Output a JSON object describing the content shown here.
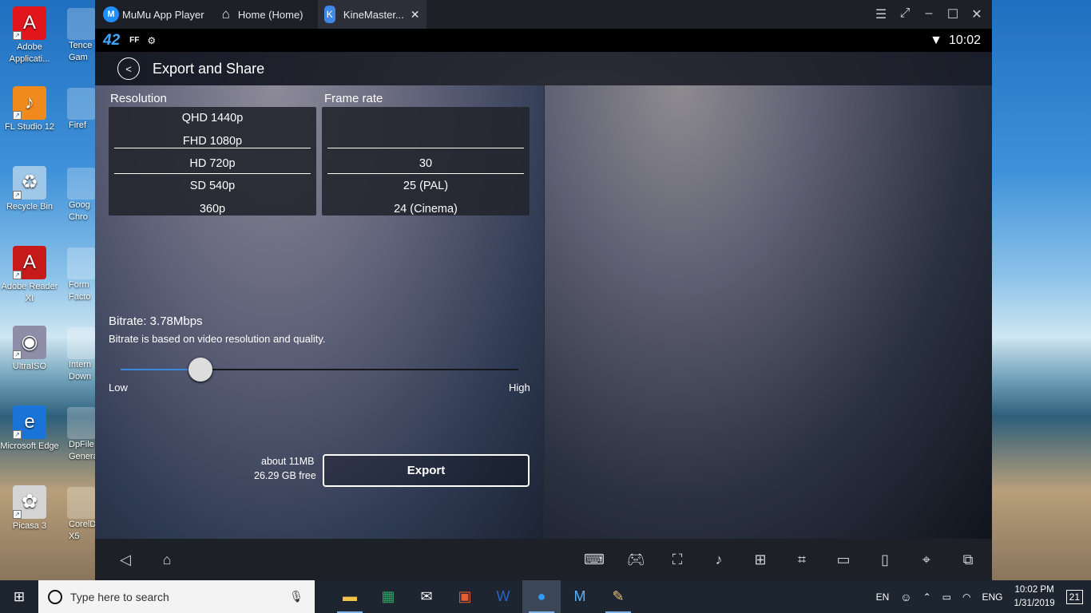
{
  "desktop": {
    "icons": [
      {
        "name": "adobe-applications-icon",
        "label": "Adobe Applicati...",
        "color": "#e0161c",
        "glyph": "A"
      },
      {
        "name": "fl-studio-icon",
        "label": "FL Studio 12",
        "color": "#f08a1c",
        "glyph": "♪"
      },
      {
        "name": "recycle-bin-icon",
        "label": "Recycle Bin",
        "color": "#9fc7e8",
        "glyph": "♻"
      },
      {
        "name": "adobe-reader-icon",
        "label": "Adobe Reader XI",
        "color": "#c71a1a",
        "glyph": "A"
      },
      {
        "name": "ultraiso-icon",
        "label": "UltraISO",
        "color": "#8e8ea8",
        "glyph": "◉"
      },
      {
        "name": "microsoft-edge-icon",
        "label": "Microsoft Edge",
        "color": "#1a74d8",
        "glyph": "e"
      },
      {
        "name": "picasa-icon",
        "label": "Picasa 3",
        "color": "#d4d4d4",
        "glyph": "✿"
      }
    ],
    "col2": [
      "Tence Gam",
      "Firef",
      "Goog Chro",
      "Form Facto",
      "Intern Down",
      "DpFile Genera",
      "CorelD X5"
    ]
  },
  "mumu": {
    "app_title": "MuMu App Player",
    "home_tab": "Home (Home)",
    "active_tab": "KineMaster...",
    "status": {
      "notif_num": "42",
      "ff": "FF",
      "time": "10:02"
    },
    "header_title": "Export and Share",
    "resolution_label": "Resolution",
    "framerate_label": "Frame rate",
    "resolutions": [
      "QHD 1440p",
      "FHD 1080p",
      "HD 720p",
      "SD 540p",
      "360p"
    ],
    "framerates": [
      "",
      "",
      "30",
      "25 (PAL)",
      "24 (Cinema)"
    ],
    "bitrate_title": "Bitrate: 3.78Mbps",
    "bitrate_desc": "Bitrate is based on video resolution and quality.",
    "slider": {
      "low": "Low",
      "high": "High",
      "value": 0.2
    },
    "size_estimate": "about 11MB",
    "free_space": "26.29 GB free",
    "export_label": "Export"
  },
  "taskbar": {
    "search_placeholder": "Type here to search",
    "lang1": "EN",
    "lang2": "ENG",
    "time": "10:02 PM",
    "date": "1/31/2019",
    "notifications": "21"
  }
}
